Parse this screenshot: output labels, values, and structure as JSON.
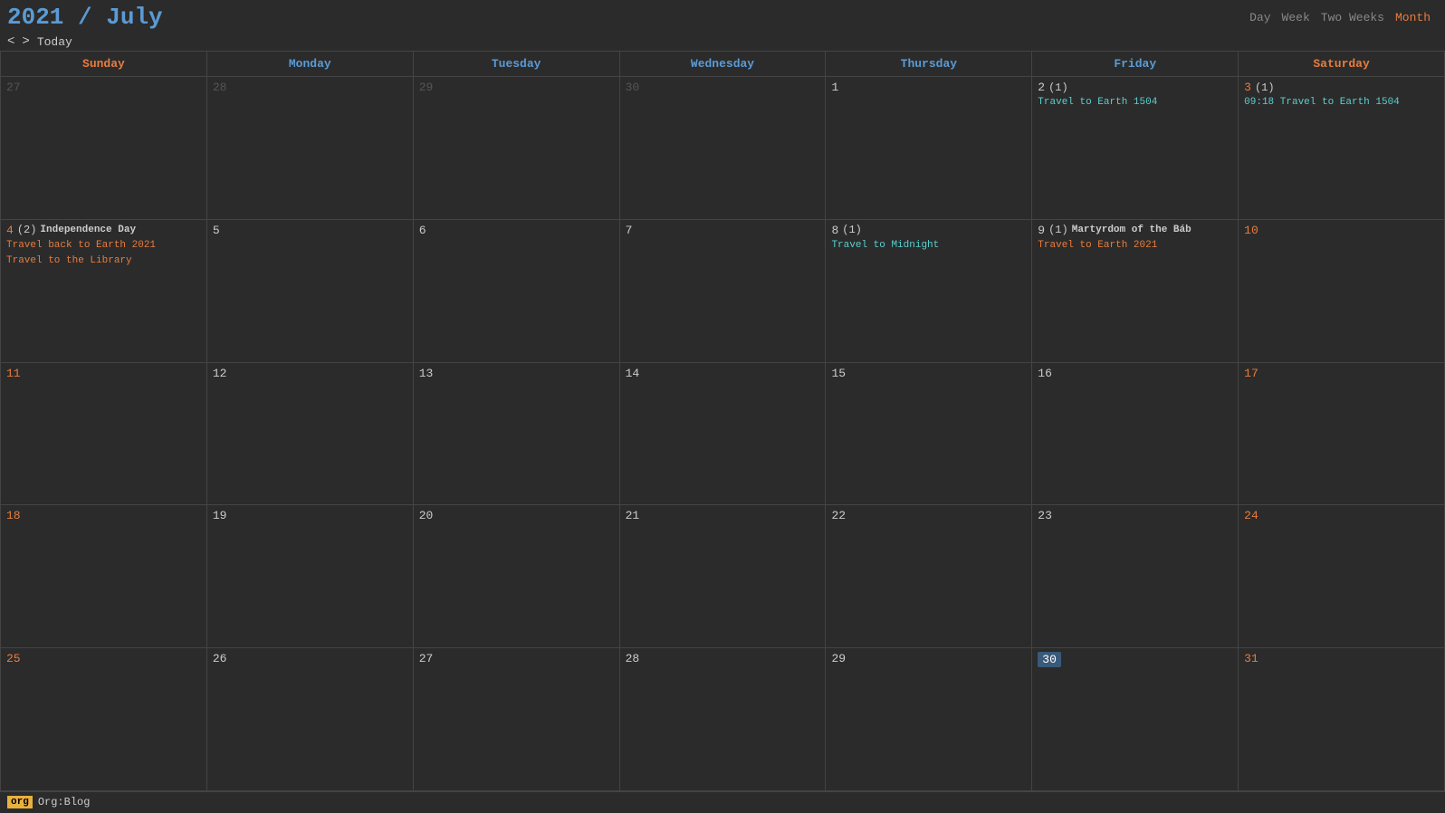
{
  "header": {
    "year": "2021",
    "slash": " / ",
    "month": "July",
    "nav_prev": "<",
    "nav_next": ">",
    "today_label": "Today",
    "views": [
      "Day",
      "Week",
      "Two Weeks",
      "Month"
    ],
    "active_view": "Month"
  },
  "day_headers": [
    {
      "label": "Sunday",
      "type": "weekend"
    },
    {
      "label": "Monday",
      "type": "weekday"
    },
    {
      "label": "Tuesday",
      "type": "weekday"
    },
    {
      "label": "Wednesday",
      "type": "weekday"
    },
    {
      "label": "Thursday",
      "type": "weekday"
    },
    {
      "label": "Friday",
      "type": "weekday"
    },
    {
      "label": "Saturday",
      "type": "weekend"
    }
  ],
  "weeks": [
    {
      "days": [
        {
          "num": "27",
          "other": true,
          "events": []
        },
        {
          "num": "28",
          "other": true,
          "events": []
        },
        {
          "num": "29",
          "other": true,
          "events": []
        },
        {
          "num": "30",
          "other": true,
          "events": []
        },
        {
          "num": "1",
          "other": false,
          "events": []
        },
        {
          "num": "2",
          "other": false,
          "count": "(1)",
          "events": [
            {
              "text": "Travel to Earth 1504",
              "type": "teal"
            }
          ]
        },
        {
          "num": "3",
          "other": false,
          "weekend": true,
          "count": "(1)",
          "events": [
            {
              "text": "09:18 Travel to Earth 1504",
              "type": "teal"
            }
          ]
        }
      ]
    },
    {
      "days": [
        {
          "num": "4",
          "other": false,
          "weekend": true,
          "count": "(2)",
          "label": "Independence Day",
          "events": [
            {
              "text": "Travel back to Earth 2021",
              "type": "orange"
            },
            {
              "text": "Travel to the Library",
              "type": "orange"
            }
          ]
        },
        {
          "num": "5",
          "other": false,
          "events": []
        },
        {
          "num": "6",
          "other": false,
          "events": []
        },
        {
          "num": "7",
          "other": false,
          "events": []
        },
        {
          "num": "8",
          "other": false,
          "count": "(1)",
          "events": [
            {
              "text": "Travel to Midnight",
              "type": "teal"
            }
          ]
        },
        {
          "num": "9",
          "other": false,
          "count": "(1)",
          "label": "Martyrdom of the Báb",
          "events": [
            {
              "text": "Travel to Earth 2021",
              "type": "orange"
            }
          ]
        },
        {
          "num": "10",
          "other": false,
          "weekend": true,
          "events": []
        }
      ]
    },
    {
      "days": [
        {
          "num": "11",
          "other": false,
          "weekend": true,
          "events": []
        },
        {
          "num": "12",
          "other": false,
          "events": []
        },
        {
          "num": "13",
          "other": false,
          "events": []
        },
        {
          "num": "14",
          "other": false,
          "events": []
        },
        {
          "num": "15",
          "other": false,
          "events": []
        },
        {
          "num": "16",
          "other": false,
          "events": []
        },
        {
          "num": "17",
          "other": false,
          "weekend": true,
          "events": []
        }
      ]
    },
    {
      "days": [
        {
          "num": "18",
          "other": false,
          "weekend": true,
          "events": []
        },
        {
          "num": "19",
          "other": false,
          "events": []
        },
        {
          "num": "20",
          "other": false,
          "events": []
        },
        {
          "num": "21",
          "other": false,
          "events": []
        },
        {
          "num": "22",
          "other": false,
          "events": []
        },
        {
          "num": "23",
          "other": false,
          "events": []
        },
        {
          "num": "24",
          "other": false,
          "weekend": true,
          "events": []
        }
      ]
    },
    {
      "days": [
        {
          "num": "25",
          "other": false,
          "weekend": true,
          "events": []
        },
        {
          "num": "26",
          "other": false,
          "events": []
        },
        {
          "num": "27",
          "other": false,
          "events": []
        },
        {
          "num": "28",
          "other": false,
          "events": []
        },
        {
          "num": "29",
          "other": false,
          "events": []
        },
        {
          "num": "30",
          "other": false,
          "today": true,
          "events": []
        },
        {
          "num": "31",
          "other": false,
          "weekend": true,
          "events": []
        }
      ]
    }
  ],
  "footer": {
    "tag": "org",
    "label": "Org:Blog"
  }
}
